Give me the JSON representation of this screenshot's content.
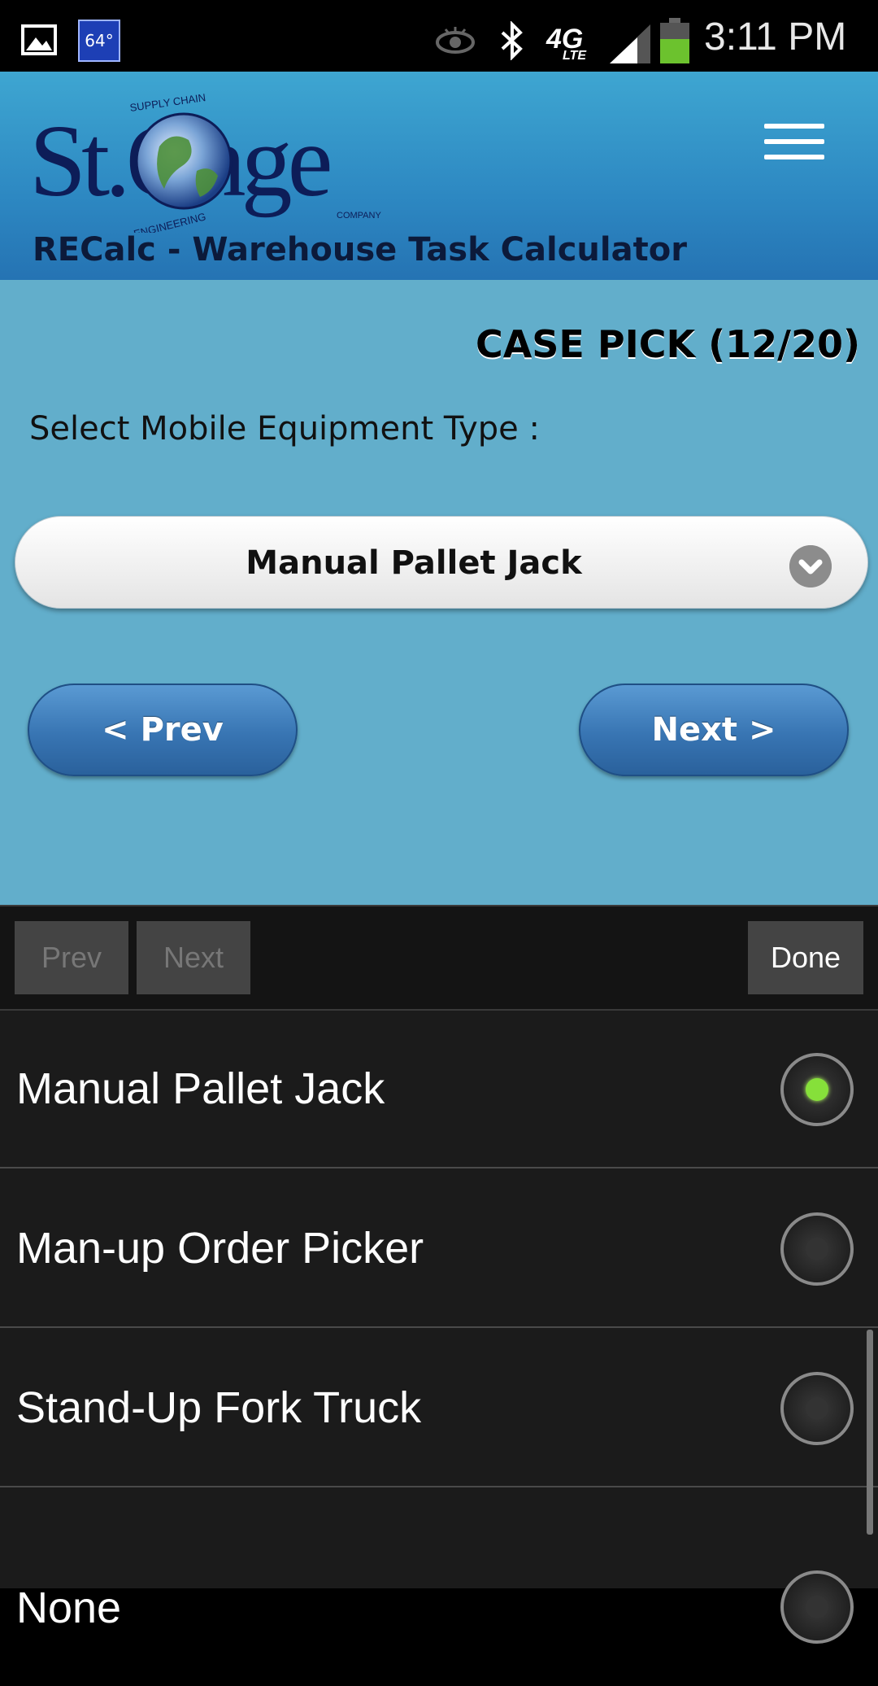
{
  "status_bar": {
    "temperature": "64°",
    "network": "4G",
    "network_sub": "LTE",
    "time": "3:11 PM"
  },
  "header": {
    "logo_text": "St.Onge",
    "logo_top_text": "SUPPLY CHAIN",
    "logo_bottom_text": "ENGINEERING",
    "logo_company_text": "COMPANY",
    "app_title": "RECalc - Warehouse Task Calculator"
  },
  "content": {
    "step_title": "CASE PICK (12/20)",
    "field_label": "Select Mobile Equipment Type :",
    "selected_value": "Manual Pallet Jack",
    "prev_label": "< Prev",
    "next_label": "Next >"
  },
  "accessory_bar": {
    "prev_label": "Prev",
    "next_label": "Next",
    "done_label": "Done"
  },
  "options": [
    {
      "label": "Manual Pallet Jack",
      "selected": true
    },
    {
      "label": "Man-up Order Picker",
      "selected": false
    },
    {
      "label": "Stand-Up Fork Truck",
      "selected": false
    },
    {
      "label": "None",
      "selected": false
    }
  ],
  "colors": {
    "header": "#2d88c2",
    "content_bg": "#62aecb",
    "button_blue": "#3875b3",
    "radio_selected": "#86e03a"
  }
}
